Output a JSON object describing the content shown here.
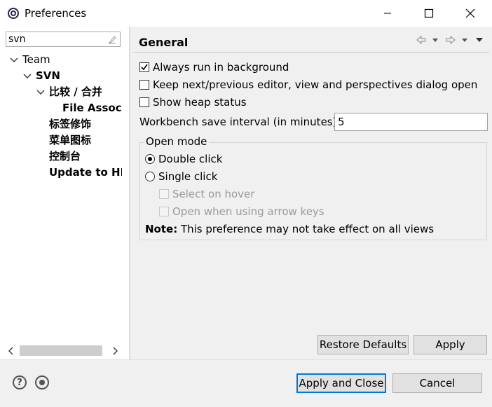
{
  "window": {
    "title": "Preferences"
  },
  "sidebar": {
    "filter_value": "svn",
    "tree": [
      {
        "label": "Team",
        "level": 0,
        "expanded": true,
        "bold": false
      },
      {
        "label": "SVN",
        "level": 1,
        "expanded": true,
        "bold": true
      },
      {
        "label": "比较 / 合并",
        "level": 2,
        "expanded": true,
        "bold": true
      },
      {
        "label": "File Associa",
        "level": 3,
        "expanded": false,
        "bold": true
      },
      {
        "label": "标签修饰",
        "level": 2,
        "expanded": false,
        "bold": true
      },
      {
        "label": "菜单图标",
        "level": 2,
        "expanded": false,
        "bold": true
      },
      {
        "label": "控制台",
        "level": 2,
        "expanded": false,
        "bold": true
      },
      {
        "label": "Update to HEA",
        "level": 2,
        "expanded": false,
        "bold": true
      }
    ]
  },
  "main": {
    "title": "General",
    "options": [
      {
        "label": "Always run in background",
        "checked": true
      },
      {
        "label": "Keep next/previous editor, view and perspectives dialog open",
        "checked": false
      },
      {
        "label": "Show heap status",
        "checked": false
      }
    ],
    "save_interval": {
      "label": "Workbench save interval (in minutes):",
      "value": "5"
    },
    "open_mode": {
      "title": "Open mode",
      "radios": [
        {
          "label": "Double click",
          "selected": true
        },
        {
          "label": "Single click",
          "selected": false
        }
      ],
      "sub_options": [
        {
          "label": "Select on hover",
          "checked": false,
          "enabled": false
        },
        {
          "label": "Open when using arrow keys",
          "checked": false,
          "enabled": false
        }
      ],
      "note_label": "Note:",
      "note_text": " This preference may not take effect on all views"
    },
    "restore_defaults_label": "Restore Defaults",
    "apply_label": "Apply"
  },
  "footer": {
    "apply_close_label": "Apply and Close",
    "cancel_label": "Cancel"
  },
  "icons": {
    "app": "eclipse-gear-icon",
    "minimize": "minimize-icon",
    "maximize": "maximize-icon",
    "close": "close-icon",
    "back": "back-arrow-icon",
    "forward": "forward-arrow-icon",
    "menu": "view-menu-icon",
    "help": "help-icon",
    "record": "record-icon"
  },
  "colors": {
    "accent": "#0078d7",
    "pane_bg": "#f0f0f0"
  }
}
